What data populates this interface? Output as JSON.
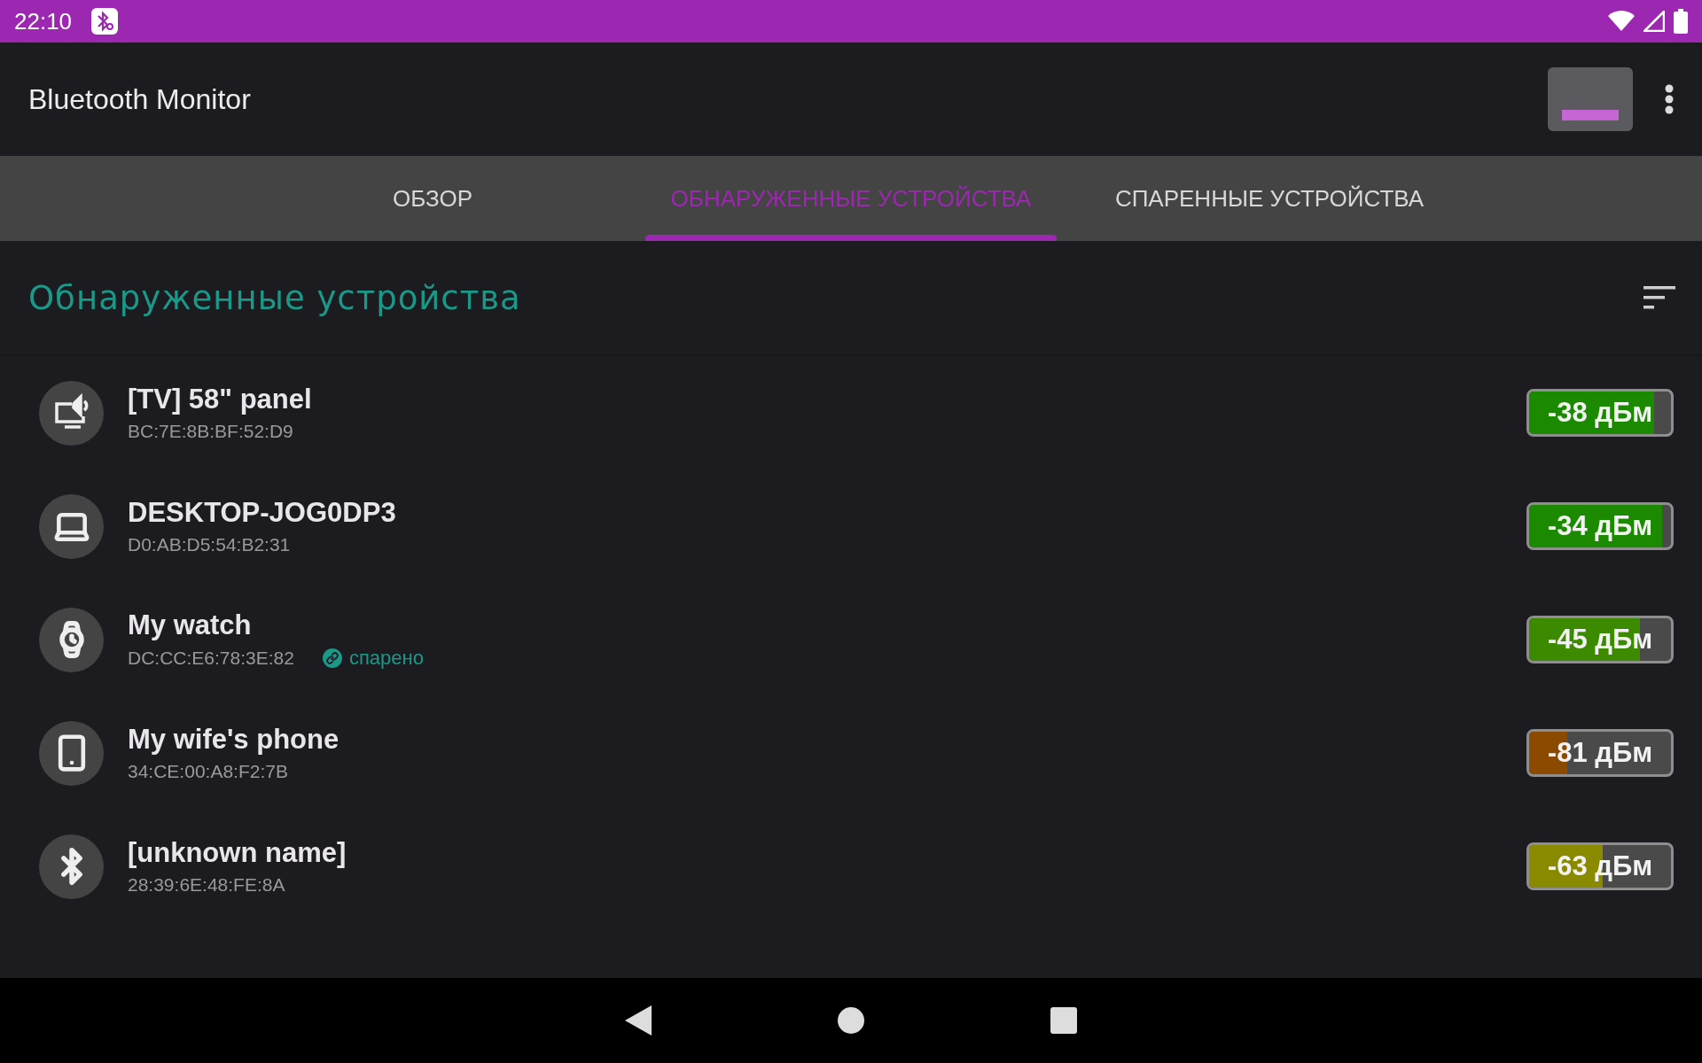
{
  "status_bar": {
    "time": "22:10"
  },
  "app_bar": {
    "title": "Bluetooth Monitor"
  },
  "tabs": [
    {
      "label": "ОБЗОР",
      "selected": false
    },
    {
      "label": "ОБНАРУЖЕННЫЕ УСТРОЙСТВА",
      "selected": true
    },
    {
      "label": "СПАРЕННЫЕ УСТРОЙСТВА",
      "selected": false
    }
  ],
  "section": {
    "title": "Обнаруженные устройства"
  },
  "devices": [
    {
      "kind": "tv",
      "name": "[TV] 58\" panel",
      "address": "BC:7E:8B:BF:52:D9",
      "reading": "-38 дБм",
      "level": 0.88,
      "color": "#1c8a00"
    },
    {
      "kind": "laptop",
      "name": "DESKTOP-JOG0DP3",
      "address": "D0:AB:D5:54:B2:31",
      "reading": "-34 дБм",
      "level": 0.94,
      "color": "#1c8a00"
    },
    {
      "kind": "watch",
      "name": "My watch",
      "address": "DC:CC:E6:78:3E:82",
      "paired_label": "спарено",
      "reading": "-45 дБм",
      "level": 0.78,
      "color": "#3c8a00"
    },
    {
      "kind": "phone",
      "name": "My wife's phone",
      "address": "34:CE:00:A8:F2:7B",
      "reading": "-81 дБм",
      "level": 0.27,
      "color": "#8c4a00"
    },
    {
      "kind": "bluetooth",
      "name": "[unknown name]",
      "address": "28:39:6E:48:FE:8A",
      "reading": "-63 дБм",
      "level": 0.52,
      "color": "#8a8a00"
    }
  ]
}
